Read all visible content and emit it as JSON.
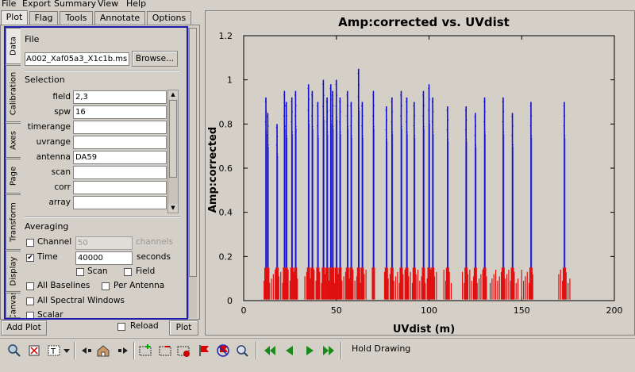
{
  "menubar": [
    "File",
    "Export",
    "Summary",
    "View",
    "Help"
  ],
  "top_tabs": [
    "Plot",
    "Flag",
    "Tools",
    "Annotate",
    "Options"
  ],
  "side_tabs": [
    "Data",
    "Calibration",
    "Axes",
    "Page",
    "Transform",
    "Display",
    "Canvas"
  ],
  "file": {
    "section": "File",
    "value": "A002_Xaf05a3_X1c1b.ms",
    "browse_label": "Browse..."
  },
  "selection": {
    "section": "Selection",
    "rows": [
      {
        "label": "field",
        "value": "2,3"
      },
      {
        "label": "spw",
        "value": "16"
      },
      {
        "label": "timerange",
        "value": ""
      },
      {
        "label": "uvrange",
        "value": ""
      },
      {
        "label": "antenna",
        "value": "DA59"
      },
      {
        "label": "scan",
        "value": ""
      },
      {
        "label": "corr",
        "value": ""
      },
      {
        "label": "array",
        "value": ""
      }
    ]
  },
  "averaging": {
    "section": "Averaging",
    "channel_label": "Channel",
    "channel_value": "50",
    "channel_units": "channels",
    "time_label": "Time",
    "time_value": "40000",
    "time_units": "seconds",
    "time_checked": "✔",
    "scan_label": "Scan",
    "field_label": "Field",
    "all_baselines_label": "All Baselines",
    "per_antenna_label": "Per Antenna",
    "all_spw_label": "All Spectral Windows",
    "scalar_label": "Scalar"
  },
  "bottom": {
    "add_plot": "Add Plot",
    "reload": "Reload",
    "plot": "Plot"
  },
  "toolbar": {
    "hold_drawing": "Hold Drawing"
  },
  "chart_data": {
    "type": "scatter",
    "title": "Amp:corrected vs. UVdist",
    "xlabel": "UVdist (m)",
    "ylabel": "Amp:corrected",
    "xlim": [
      0,
      200
    ],
    "ylim": [
      0,
      1.2
    ],
    "xticks": [
      0,
      50,
      100,
      150,
      200
    ],
    "yticks": [
      0,
      0.2,
      0.4,
      0.6,
      0.8,
      1.0,
      1.2
    ],
    "xtick_labels": [
      "0",
      "50",
      "100",
      "150",
      "200"
    ],
    "ytick_labels": [
      "0",
      "0.2",
      "0.4",
      "0.6",
      "0.8",
      "1",
      "1.2"
    ],
    "colors": {
      "high": "#1010d0",
      "low": "#e01010"
    },
    "series": [
      {
        "name": "",
        "color": "#1010d0",
        "points": [
          {
            "x": 12,
            "ymax": 0.92
          },
          {
            "x": 13,
            "ymax": 0.85
          },
          {
            "x": 18,
            "ymax": 0.8
          },
          {
            "x": 22,
            "ymax": 0.95
          },
          {
            "x": 23,
            "ymax": 0.9
          },
          {
            "x": 26,
            "ymax": 0.92
          },
          {
            "x": 28,
            "ymax": 0.95
          },
          {
            "x": 35,
            "ymax": 0.98
          },
          {
            "x": 37,
            "ymax": 0.95
          },
          {
            "x": 40,
            "ymax": 0.9
          },
          {
            "x": 43,
            "ymax": 1.0
          },
          {
            "x": 45,
            "ymax": 0.92
          },
          {
            "x": 47,
            "ymax": 0.98
          },
          {
            "x": 48,
            "ymax": 0.95
          },
          {
            "x": 50,
            "ymax": 1.0
          },
          {
            "x": 52,
            "ymax": 0.92
          },
          {
            "x": 56,
            "ymax": 0.95
          },
          {
            "x": 58,
            "ymax": 0.9
          },
          {
            "x": 62,
            "ymax": 1.05
          },
          {
            "x": 64,
            "ymax": 0.9
          },
          {
            "x": 70,
            "ymax": 0.95
          },
          {
            "x": 77,
            "ymax": 0.88
          },
          {
            "x": 80,
            "ymax": 0.92
          },
          {
            "x": 85,
            "ymax": 0.95
          },
          {
            "x": 88,
            "ymax": 0.92
          },
          {
            "x": 92,
            "ymax": 0.9
          },
          {
            "x": 97,
            "ymax": 0.95
          },
          {
            "x": 100,
            "ymax": 0.98
          },
          {
            "x": 102,
            "ymax": 0.92
          },
          {
            "x": 110,
            "ymax": 0.88
          },
          {
            "x": 120,
            "ymax": 0.88
          },
          {
            "x": 125,
            "ymax": 0.85
          },
          {
            "x": 130,
            "ymax": 0.92
          },
          {
            "x": 140,
            "ymax": 0.92
          },
          {
            "x": 145,
            "ymax": 0.85
          },
          {
            "x": 155,
            "ymax": 0.9
          },
          {
            "x": 173,
            "ymax": 0.9
          }
        ]
      },
      {
        "name": "",
        "color": "#e01010",
        "low_band_max": 0.15
      }
    ],
    "grid": false
  }
}
